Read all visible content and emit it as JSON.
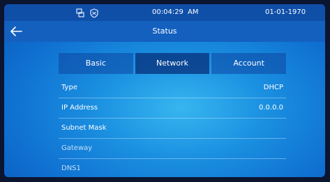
{
  "status_bar": {
    "time": "00:04:29",
    "ampm": "AM",
    "date": "01-01-1970",
    "icons": [
      "network-icon",
      "shield-icon"
    ]
  },
  "header": {
    "title": "Status",
    "back_icon": "back-arrow-icon"
  },
  "tabs": [
    {
      "label": "Basic",
      "active": false
    },
    {
      "label": "Network",
      "active": true
    },
    {
      "label": "Account",
      "active": false
    }
  ],
  "network": {
    "rows": [
      {
        "label": "Type",
        "value": "DHCP"
      },
      {
        "label": "IP Address",
        "value": "0.0.0.0"
      },
      {
        "label": "Subnet Mask",
        "value": ""
      },
      {
        "label": "Gateway",
        "value": ""
      },
      {
        "label": "DNS1",
        "value": ""
      }
    ]
  }
}
